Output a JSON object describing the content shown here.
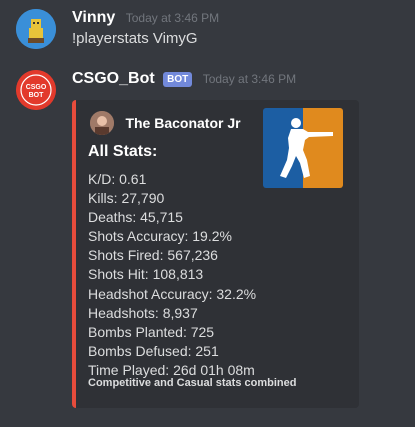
{
  "messages": [
    {
      "author": "Vinny",
      "timestamp": "Today at 3:46 PM",
      "content": "!playerstats VimyG"
    },
    {
      "author": "CSGO_Bot",
      "badge": "BOT",
      "timestamp": "Today at 3:46 PM",
      "avatar_text": [
        "CSGO",
        "BOT"
      ],
      "embed": {
        "accent_color": "#e74c3c",
        "author_name": "The Baconator Jr",
        "title": "All Stats:",
        "stats": [
          "K/D: 0.61",
          "Kills: 27,790",
          "Deaths: 45,715",
          "Shots Accuracy: 19.2%",
          "Shots Fired: 567,236",
          "Shots Hit: 108,813",
          "Headshot Accuracy: 32.2%",
          "Headshots: 8,937",
          "Bombs Planted: 725",
          "Bombs Defused: 251",
          "Time Played: 26d 01h 08m"
        ],
        "footer": "Competitive and Casual stats combined",
        "thumbnail_icon": "csgo-logo-icon"
      }
    }
  ],
  "colors": {
    "background": "#36393f",
    "embed_background": "#2f3136",
    "bot_badge": "#7289da",
    "logo_blue": "#1c5ea3",
    "logo_orange": "#e08a1e"
  }
}
